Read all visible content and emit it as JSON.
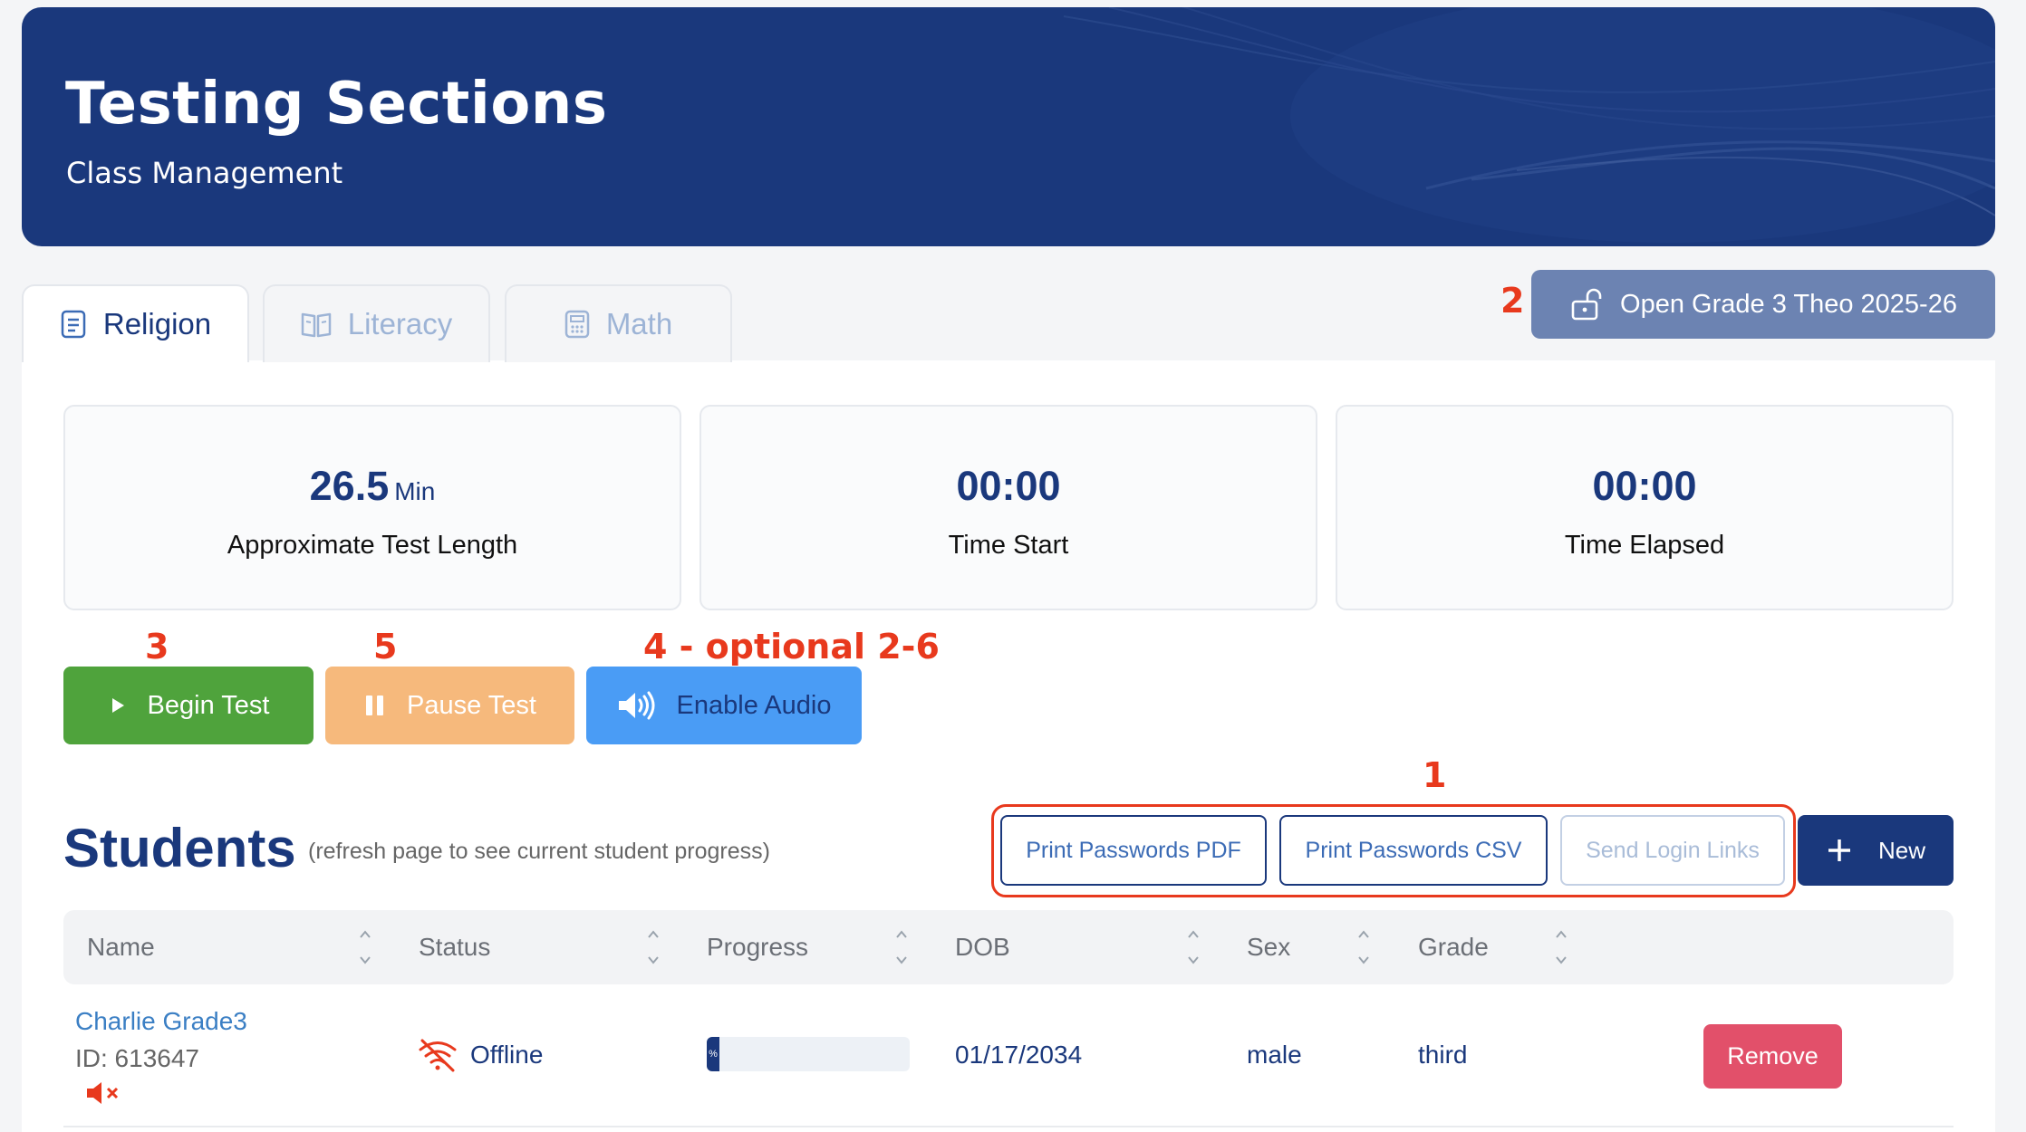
{
  "header": {
    "title": "Testing Sections",
    "subtitle": "Class Management"
  },
  "tabs": [
    {
      "label": "Religion",
      "icon": "document-icon",
      "active": true
    },
    {
      "label": "Literacy",
      "icon": "book-icon",
      "active": false
    },
    {
      "label": "Math",
      "icon": "calculator-icon",
      "active": false
    }
  ],
  "annotations": {
    "open": "2",
    "begin": "3",
    "pause": "5",
    "audio": "4 - optional 2-6",
    "print": "1"
  },
  "open_button": {
    "label": "Open Grade 3 Theo 2025-26",
    "icon": "unlock-icon"
  },
  "stats": [
    {
      "value": "26.5",
      "unit": "Min",
      "label": "Approximate Test Length"
    },
    {
      "value": "00:00",
      "unit": "",
      "label": "Time Start"
    },
    {
      "value": "00:00",
      "unit": "",
      "label": "Time Elapsed"
    }
  ],
  "actions": {
    "begin": {
      "label": "Begin Test",
      "icon": "play-icon",
      "color": "#4fa33c"
    },
    "pause": {
      "label": "Pause Test",
      "icon": "pause-icon",
      "color": "#f6b97c"
    },
    "audio": {
      "label": "Enable Audio",
      "icon": "speaker-icon",
      "color": "#4a9cf5"
    }
  },
  "students": {
    "title": "Students",
    "note": "(refresh page to see current student progress)",
    "buttons": {
      "print_pdf": "Print Passwords PDF",
      "print_csv": "Print Passwords CSV",
      "send_links": "Send Login Links",
      "new": "New"
    },
    "columns": [
      "Name",
      "Status",
      "Progress",
      "DOB",
      "Sex",
      "Grade"
    ],
    "rows": [
      {
        "name": "Charlie Grade3",
        "id": "ID: 613647",
        "status": "Offline",
        "progress_text": "%",
        "progress": 0,
        "dob": "01/17/2034",
        "sex": "male",
        "grade": "third",
        "action": "Remove"
      }
    ]
  }
}
